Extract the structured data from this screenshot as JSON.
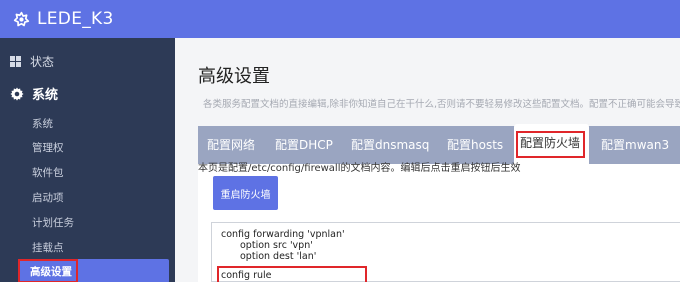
{
  "header": {
    "brand": "LEDE_K3",
    "brand_icon": "lede-logo-icon",
    "background": "#5e72e4"
  },
  "sidebar": {
    "status_label": "状态",
    "system_label": "系统",
    "items": [
      {
        "label": "系统"
      },
      {
        "label": "管理权"
      },
      {
        "label": "软件包"
      },
      {
        "label": "启动项"
      },
      {
        "label": "计划任务"
      },
      {
        "label": "挂载点"
      },
      {
        "label": "高级设置",
        "active": true
      }
    ]
  },
  "main": {
    "title": "高级设置",
    "description": "各类服务配置文档的直接编辑,除非你知道自己在干什么,否则请不要轻易修改这些配置文档。配置不正确可能会导致",
    "tabs": [
      {
        "label": "配置网络"
      },
      {
        "label": "配置DHCP"
      },
      {
        "label": "配置dnsmasq"
      },
      {
        "label": "配置hosts"
      },
      {
        "label": "配置防火墙",
        "active": true
      },
      {
        "label": "配置mwan3"
      }
    ],
    "hint": "本页是配置/etc/config/firewall的文档内容。编辑后点击重启按钮后生效",
    "restart_button": "重启防火墙",
    "code_lines": [
      "config forwarding 'vpnlan'",
      "option src 'vpn'",
      "option dest 'lan'",
      "config rule"
    ]
  },
  "colors": {
    "accent": "#5e72e4",
    "sidebar_bg": "#2d3a56",
    "highlight_red": "#e0262a"
  }
}
